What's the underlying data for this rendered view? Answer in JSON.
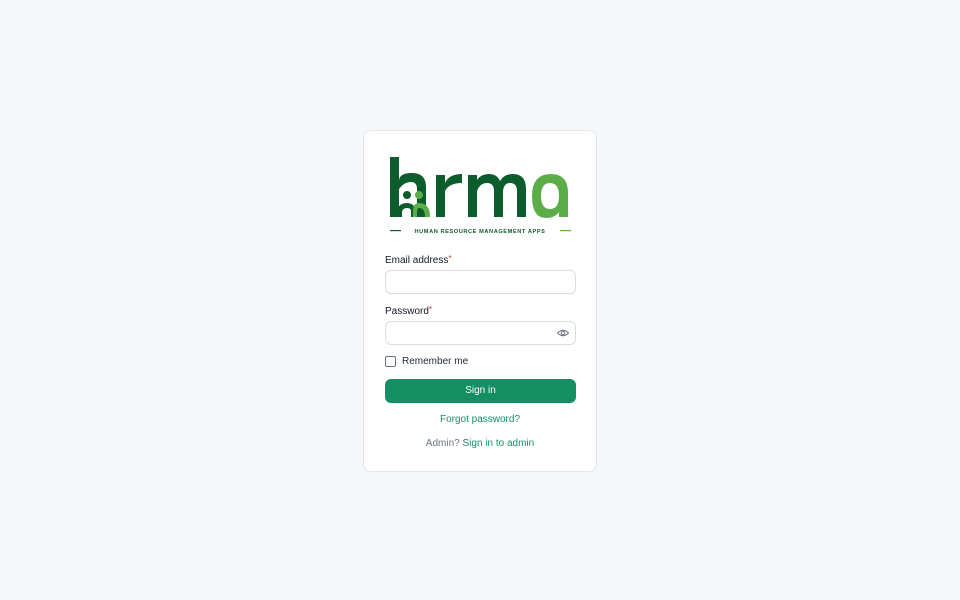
{
  "brand": {
    "logo_text": "hrma",
    "tagline": "HUMAN RESOURCE MANAGEMENT APPS",
    "colors": {
      "dark_green": "#0d5c2b",
      "light_green": "#5aad47"
    }
  },
  "form": {
    "email": {
      "label": "Email address",
      "required_marker": "*",
      "value": "",
      "placeholder": ""
    },
    "password": {
      "label": "Password",
      "required_marker": "*",
      "value": "",
      "placeholder": "",
      "toggle_icon": "eye-icon"
    },
    "remember": {
      "label": "Remember me",
      "checked": false
    },
    "submit_label": "Sign in",
    "forgot_label": "Forgot password?",
    "admin_prefix": "Admin?",
    "admin_link": "Sign in to admin"
  },
  "colors": {
    "accent": "#138f63",
    "background": "#f5f7fa"
  }
}
